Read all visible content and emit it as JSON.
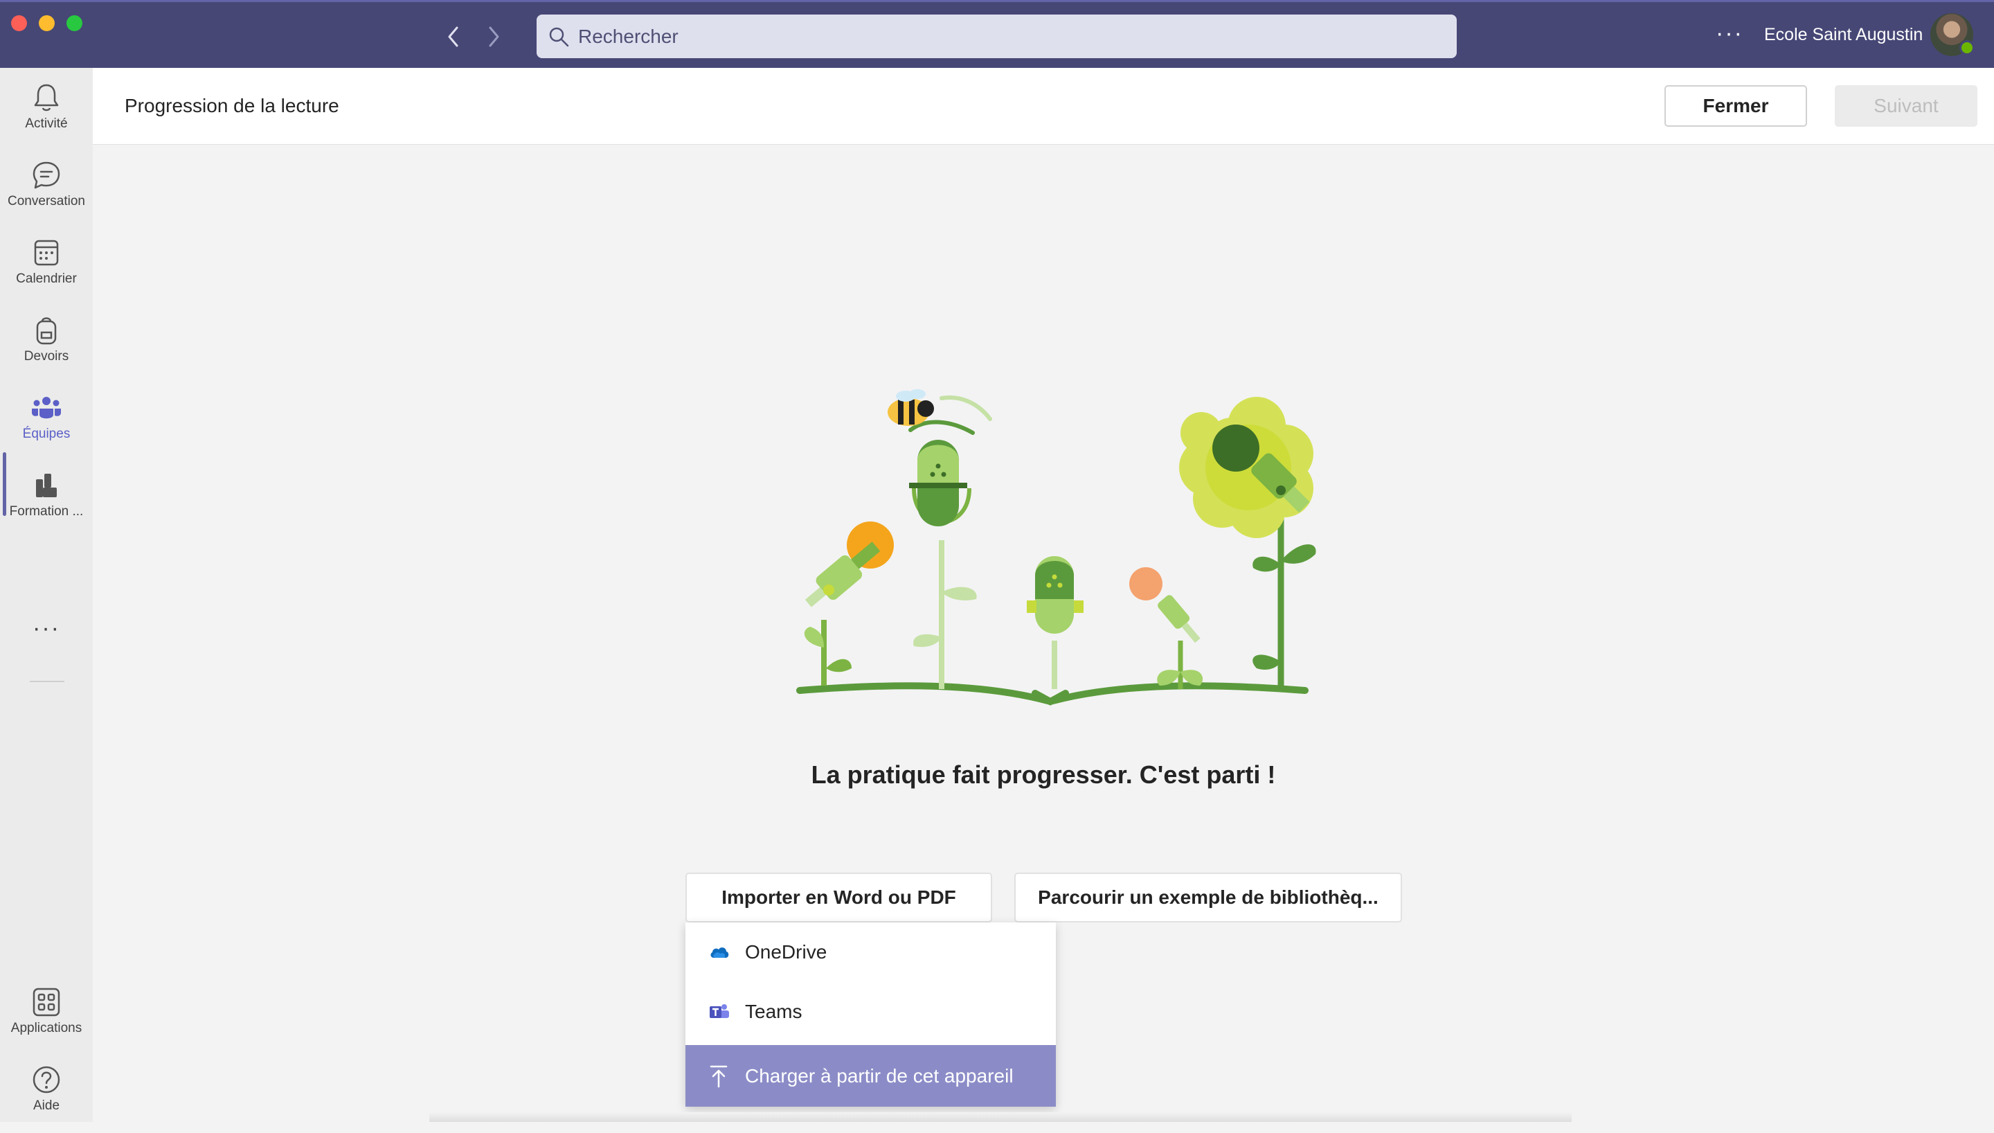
{
  "window": {
    "search_placeholder": "Rechercher",
    "more_label": "···",
    "org_name": "Ecole Saint Augustin"
  },
  "rail": {
    "items": [
      {
        "label": "Activité",
        "icon": "bell-icon"
      },
      {
        "label": "Conversation",
        "icon": "chat-icon"
      },
      {
        "label": "Calendrier",
        "icon": "calendar-icon"
      },
      {
        "label": "Devoirs",
        "icon": "backpack-icon"
      },
      {
        "label": "Équipes",
        "icon": "teams-icon",
        "active": true
      },
      {
        "label": "Formation ...",
        "icon": "learning-icon"
      }
    ],
    "more_label": "···",
    "bottom": [
      {
        "label": "Applications",
        "icon": "apps-icon"
      },
      {
        "label": "Aide",
        "icon": "help-icon"
      }
    ]
  },
  "header": {
    "title": "Progression de la lecture",
    "close_label": "Fermer",
    "next_label": "Suivant"
  },
  "main": {
    "tagline": "La pratique fait progresser. C'est parti !",
    "import_label": "Importer en Word ou PDF",
    "browse_label": "Parcourir un exemple de bibliothèq..."
  },
  "dropdown": {
    "items": [
      {
        "label": "OneDrive",
        "icon": "onedrive-icon"
      },
      {
        "label": "Teams",
        "icon": "teams-app-icon"
      },
      {
        "label": "Charger à partir de cet appareil",
        "icon": "upload-icon",
        "highlighted": true
      }
    ]
  },
  "colors": {
    "titlebar": "#464775",
    "accent": "#6264a7",
    "highlight": "#8b8cc7"
  }
}
